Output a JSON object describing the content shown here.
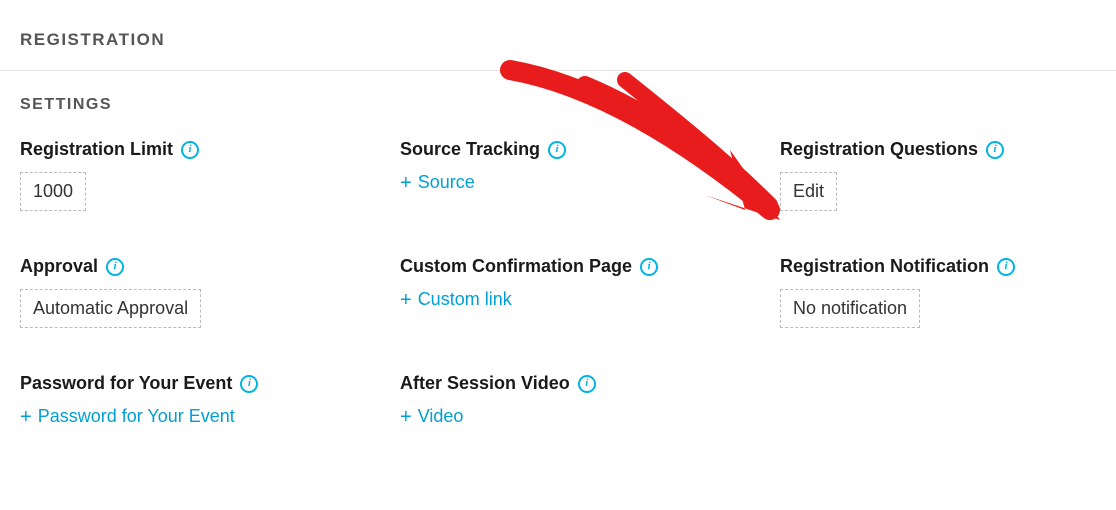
{
  "header": {
    "title": "REGISTRATION"
  },
  "subtitle": "SETTINGS",
  "fields": {
    "reg_limit": {
      "label": "Registration Limit",
      "value": "1000"
    },
    "source": {
      "label": "Source Tracking",
      "action": "Source"
    },
    "questions": {
      "label": "Registration Questions",
      "value": "Edit"
    },
    "approval": {
      "label": "Approval",
      "value": "Automatic Approval"
    },
    "confirm": {
      "label": "Custom Confirmation Page",
      "action": "Custom link"
    },
    "notify": {
      "label": "Registration Notification",
      "value": "No notification"
    },
    "password": {
      "label": "Password for Your Event",
      "action": "Password for Your Event"
    },
    "after_video": {
      "label": "After Session Video",
      "action": "Video"
    }
  },
  "annotation": {
    "type": "arrow",
    "color": "#e81c1c",
    "target": "registration-questions-edit-button"
  }
}
